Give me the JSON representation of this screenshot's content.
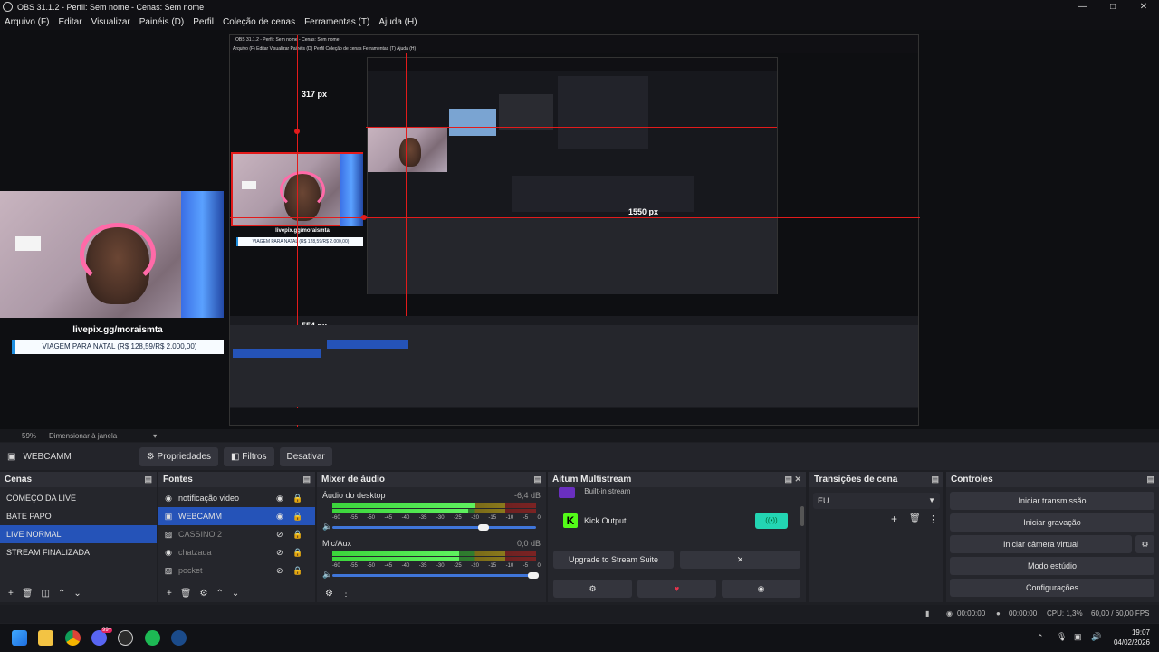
{
  "window": {
    "title": "OBS 31.1.2 - Perfil: Sem nome - Cenas: Sem nome",
    "minimize": "—",
    "maximize": "□",
    "close": "✕"
  },
  "menu": [
    "Arquivo (F)",
    "Editar",
    "Visualizar",
    "Painéis (D)",
    "Perfil",
    "Coleção de cenas",
    "Ferramentas (T)",
    "Ajuda (H)"
  ],
  "preview": {
    "livepix_url": "livepix.gg/moraismta",
    "donation_goal": "VIAGEM PARA NATAL (R$ 128,59/R$ 2.000,00)",
    "measure_top": "317 px",
    "measure_side": "1550 px",
    "measure_bottom": "554 px",
    "inner_title": "OBS 31.1.2 - Perfil: Sem nome - Cenas: Sem nome",
    "inner_menu": "Arquivo (F)   Editar   Visualizar   Painéis (D)   Perfil   Coleção de cenas   Ferramentas (T)   Ajuda (H)",
    "inner_livepix_url": "livepix.gg/moraismta",
    "inner_donation_goal": "VIAGEM PARA NATAL (R$ 128,59/R$ 2.000,00)"
  },
  "preview_bar": {
    "zoom": "59%",
    "scale_mode": "Dimensionar à janela"
  },
  "source_toolbar": {
    "source_name": "WEBCAMM",
    "properties": "Propriedades",
    "filters": "Filtros",
    "disable": "Desativar"
  },
  "scenes": {
    "title": "Cenas",
    "items": [
      "COMEÇO DA LIVE",
      "BATE PAPO",
      "LIVE NORMAL",
      "STREAM FINALIZADA"
    ],
    "selected_index": 2
  },
  "sources": {
    "title": "Fontes",
    "items": [
      {
        "name": "notificação video",
        "icon": "browser-icon",
        "visible": true
      },
      {
        "name": "WEBCAMM",
        "icon": "camera-icon",
        "visible": true
      },
      {
        "name": "CASSINO 2",
        "icon": "image-icon",
        "visible": false
      },
      {
        "name": "chatzada",
        "icon": "browser-icon",
        "visible": false
      },
      {
        "name": "pocket",
        "icon": "image-icon",
        "visible": false
      }
    ]
  },
  "mixer": {
    "title": "Mixer de áudio",
    "channels": [
      {
        "name": "Áudio do desktop",
        "db": "-6,4 dB",
        "level": 0.7,
        "volume": 0.72
      },
      {
        "name": "Mic/Aux",
        "db": "0,0 dB",
        "level": 0.62,
        "volume": 0.97
      }
    ],
    "ticks": [
      "-60",
      "-55",
      "-50",
      "-45",
      "-40",
      "-35",
      "-30",
      "-25",
      "-20",
      "-15",
      "-10",
      "-5",
      "0"
    ]
  },
  "multistream": {
    "title": "Aitum Multistream",
    "partial_row": "Built-in stream",
    "kick_label": "Kick Output",
    "upgrade": "Upgrade to Stream Suite",
    "dismiss": "✕"
  },
  "transitions": {
    "title": "Transições de cena",
    "selected": "EU"
  },
  "controls": {
    "title": "Controles",
    "buttons": [
      "Iniciar transmissão",
      "Iniciar gravação",
      "Iniciar câmera virtual",
      "Modo estúdio",
      "Configurações"
    ]
  },
  "status": {
    "stream_time": "00:00:00",
    "rec_time": "00:00:00",
    "cpu": "CPU: 1,3%",
    "fps": "60,00 / 60,00 FPS"
  },
  "taskbar": {
    "time": "19:07",
    "date": "04/02/2026",
    "discord_badge": "99+"
  },
  "colors": {
    "selected": "#2553b8",
    "accent_red": "#e21b1b",
    "kick_green": "#53fc18",
    "toggle_teal": "#23d5b3"
  }
}
